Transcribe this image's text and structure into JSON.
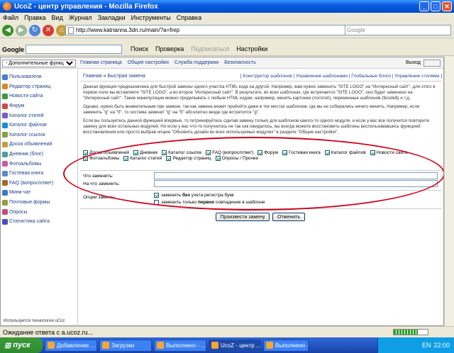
{
  "window": {
    "title": "UcoZ - центр управления - Mozilla Firefox"
  },
  "menu": [
    "Файл",
    "Правка",
    "Вид",
    "Журнал",
    "Закладки",
    "Инструменты",
    "Справка"
  ],
  "nav": {
    "url": "http://www.katrianna.3dn.ru/main/?a=frep",
    "search_placeholder": "Google"
  },
  "gbar": {
    "logo": "Google",
    "search": "Поиск",
    "check": "Проверка",
    "subscribe": "Подписаться",
    "settings": "Настройки"
  },
  "ucoz_top": {
    "select_value": "- Дополнительные функции -",
    "links": [
      "Главная страница",
      "Общие настройки",
      "Служба поддержки",
      "Безопасность"
    ],
    "exit": "Выход"
  },
  "sidebar": {
    "items": [
      "Пользователи",
      "Редактор страниц",
      "Новости сайта",
      "Форум",
      "Каталог статей",
      "Каталог файлов",
      "Каталог ссылок",
      "Доска объявлений",
      "Дневник (блог)",
      "Фотоальбомы",
      "Гостевая книга",
      "FAQ (вопрос/ответ)",
      "Мини-чат",
      "Почтовые формы",
      "Опросы",
      "Статистика сайта"
    ],
    "icon_colors": [
      "#4a7fc8",
      "#d98a1c",
      "#3a9a3a",
      "#c84a4a",
      "#7a5ac8",
      "#1c8ad9",
      "#8aa03a",
      "#c8a03a",
      "#4aa0a0",
      "#c85aa0",
      "#5a8ac8",
      "#a06a2a",
      "#3a7ac8",
      "#9a9a3a",
      "#c84a7a",
      "#4a4ac8"
    ],
    "footer": "Используется технология uCoz"
  },
  "main": {
    "crumb_home": "Главная",
    "crumb_page": "Быстрая замена",
    "right_links": "[ Конструктор шаблонов | Управление шаблонами | Глобальные блоги | Управление стилями ]",
    "descr1": "Данная функция предназначена для быстрой замены одного участка HTML кода на другой. Например, вам нужно заменить \"SITE LOGO\" на \"Интересный сайт\", для этого в первое поле вы вставляете \"SITE LOGO\", а во второе \"Интересный сайт\". В результате, во всех шаблонах, где встречается \"SITE LOGO\", оно будет заменено на \"Интересный сайт\". Такие манипуляции можно проделывать с любым HTML кодом, например, менять картинки (логотип), переменные шаблонов ($code$) и т.д.",
    "descr2": "Однако, нужно быть внимательным при замене, так как замена может пройойти даже в тех местах шаблонов, где вы не собирались ничего менять. Например, если заменить \"g\" на \"б\", то система заменит \"g\" на \"б\" абсолютно везде где встретится \"g\".",
    "descr3": "Если вы пользуетесь данной функцией впервые, то потренируйтесь сделав замену только для шаблонов какого-то одного модуля, и если у вас все получится повторите замену для всех остальных модулей. Но если у вас что-то получилось не так как ожидалось, вы всегда можете восстановить шаблоны воспользовавшись функцией восстановления или просто выбрав опцию \"Обновить дизайн во всех используемых модулях\" в разделе \"Общие настройки\".",
    "modules": [
      "Доска объявлений",
      "Дневник",
      "Каталог ссылок",
      "FAQ (вопрос/ответ)",
      "Форум",
      "Гостевая книга",
      "Каталог файлов",
      "Новости сайта",
      "Фотоальбомы",
      "Каталог статей",
      "Редактор страниц",
      "Опросы / Прочее"
    ],
    "replace_label": "Что заменить:",
    "with_label": "На что заменить:",
    "options_label": "Опции замены:",
    "opt1_pre": "заменять ",
    "opt1_bold": "без",
    "opt1_post": " учета регистра букв",
    "opt2_pre": "заменить только ",
    "opt2_bold": "первое",
    "opt2_post": " совпадение в шаблоне",
    "btn_replace": "Произвести замену",
    "btn_cancel": "Отменить"
  },
  "status": {
    "text": "Ожидание ответа с a.ucoz.ru...",
    "progress": 0.7
  },
  "taskbar": {
    "start": "пуск",
    "tasks": [
      "Добавление ...",
      "Загрузки",
      "Выполнено - ...",
      "UcoZ - центр ...",
      "Выполнено - ..."
    ],
    "time": "22:00",
    "lang": "EN"
  }
}
